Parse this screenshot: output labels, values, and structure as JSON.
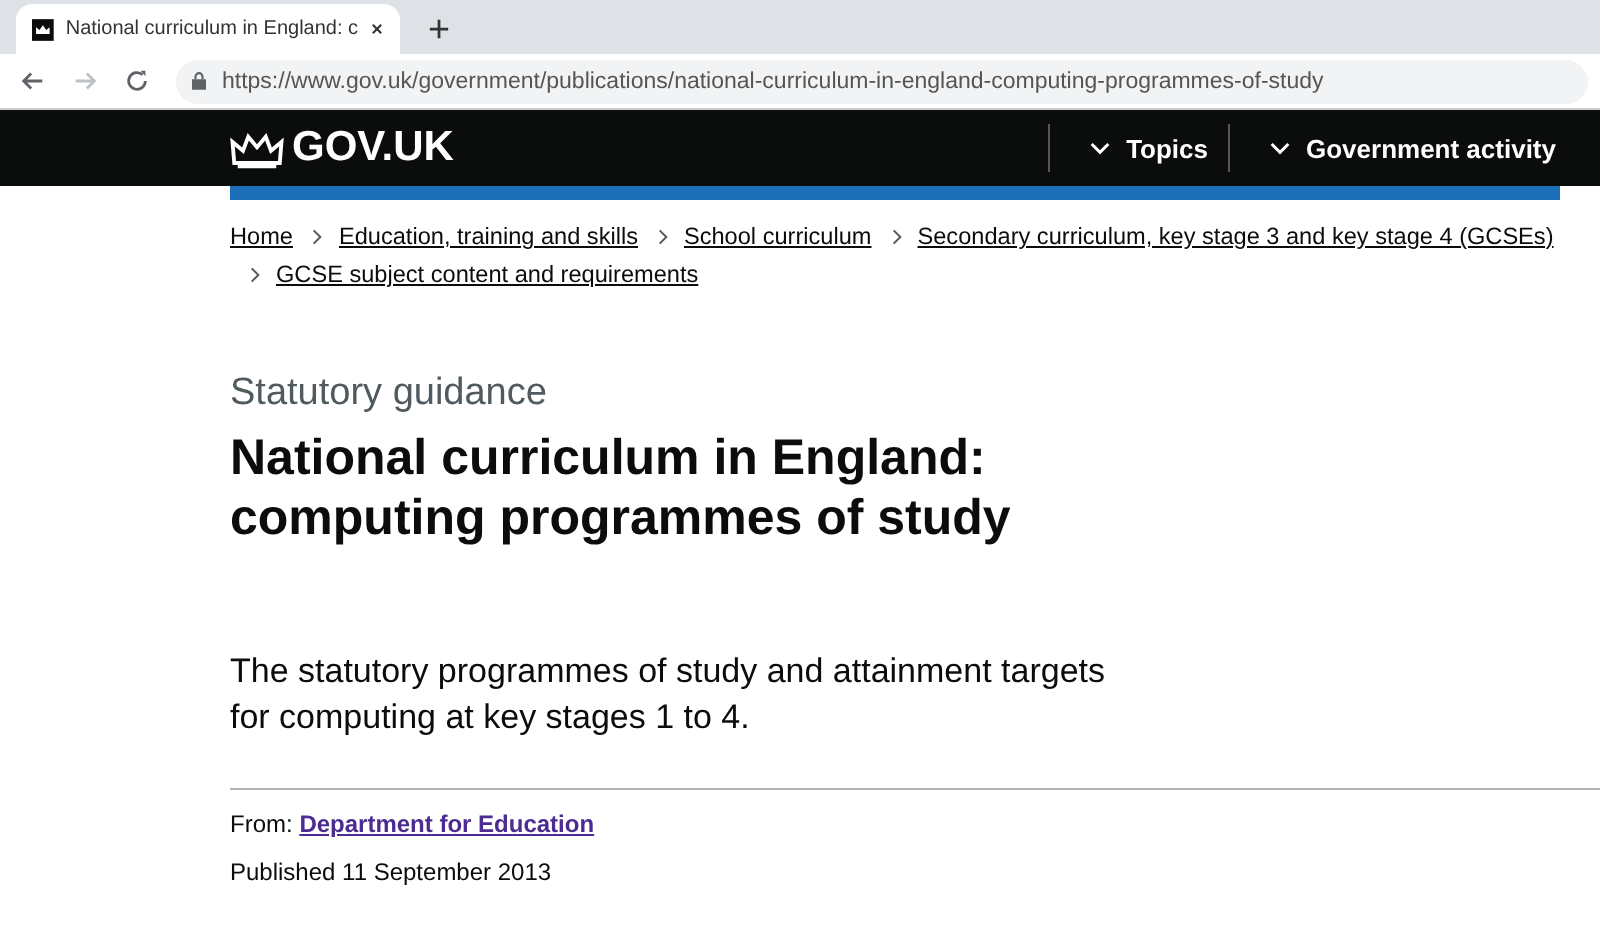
{
  "browser": {
    "tab": {
      "title": "National curriculum in England: c"
    },
    "url": "https://www.gov.uk/government/publications/national-curriculum-in-england-computing-programmes-of-study"
  },
  "header": {
    "logo": "GOV.UK",
    "nav": [
      {
        "label": "Topics",
        "expanded": false
      },
      {
        "label": "Government activity",
        "expanded": false
      }
    ]
  },
  "breadcrumbs": [
    "Home",
    "Education, training and skills",
    "School curriculum",
    "Secondary curriculum, key stage 3 and key stage 4 (GCSEs)",
    "GCSE subject content and requirements"
  ],
  "page": {
    "caption": "Statutory guidance",
    "title": "National curriculum in England: computing programmes of study",
    "summary": "The statutory programmes of study and attainment targets for computing at key stages 1 to 4.",
    "from_label": "From:",
    "from_link": "Department for Education",
    "published": "Published 11 September 2013"
  }
}
